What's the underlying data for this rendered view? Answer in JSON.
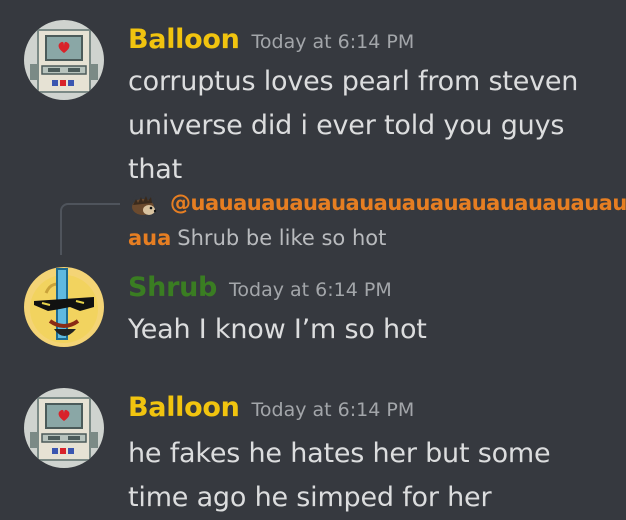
{
  "messages": [
    {
      "username": "Balloon",
      "username_color": "#f1c40f",
      "timestamp": "Today at 6:14 PM",
      "avatar_icon": "balloon-robot-avatar",
      "text": "corruptus loves pearl from steven universe did i ever told you guys that"
    },
    {
      "reply": {
        "mention": "@uauauauauauauauauauauauauauauau",
        "mention_tail": "aua",
        "text": "Shrub be like so hot",
        "mention_color": "#e67e22",
        "avatar_icon": "hedgehog-avatar"
      },
      "username": "Shrub",
      "username_color": "#3a7d22",
      "timestamp": "Today at 6:14 PM",
      "avatar_icon": "shrub-sunglasses-avatar",
      "text": "Yeah I know I’m so hot"
    },
    {
      "username": "Balloon",
      "username_color": "#f1c40f",
      "timestamp": "Today at 6:14 PM",
      "avatar_icon": "balloon-robot-avatar",
      "text": "he fakes he hates her but some time ago he simped for her"
    }
  ]
}
